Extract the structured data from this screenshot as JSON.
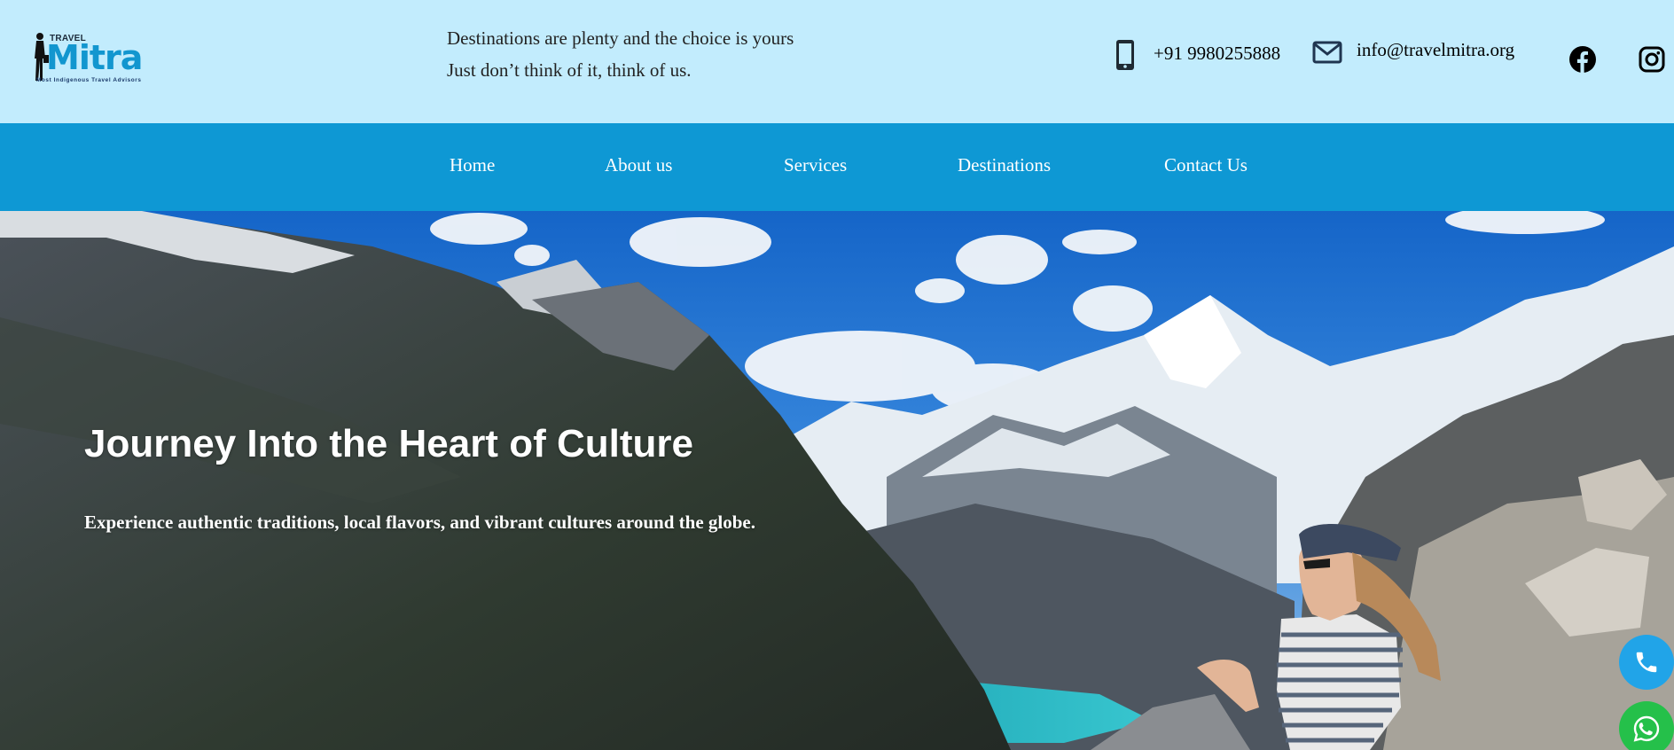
{
  "brand": {
    "logo_top_text": "TRAVEL",
    "logo_main_text": "Mitra",
    "logo_tagline": "Most Indigenous Travel Advisors"
  },
  "header": {
    "tagline_line1": "Destinations are plenty and the choice is yours",
    "tagline_line2": "Just don’t think of it, think of us.",
    "phone": "+91 9980255888",
    "email": "info@travelmitra.org",
    "icons": [
      "phone-icon",
      "mail-icon",
      "facebook-icon",
      "instagram-icon"
    ]
  },
  "nav": {
    "items": [
      {
        "label": "Home"
      },
      {
        "label": "About us"
      },
      {
        "label": "Services"
      },
      {
        "label": "Destinations"
      },
      {
        "label": "Contact Us"
      }
    ]
  },
  "hero": {
    "title": "Journey Into the Heart of Culture",
    "subtitle": "Experience authentic traditions, local flavors, and vibrant cultures around the globe."
  },
  "floating_buttons": [
    "phone-call-icon",
    "whatsapp-icon"
  ],
  "colors": {
    "topbar_bg": "#c2ecfd",
    "nav_bg": "#0e98d4",
    "call_button": "#21a4e8",
    "whatsapp_button": "#25c04a"
  }
}
